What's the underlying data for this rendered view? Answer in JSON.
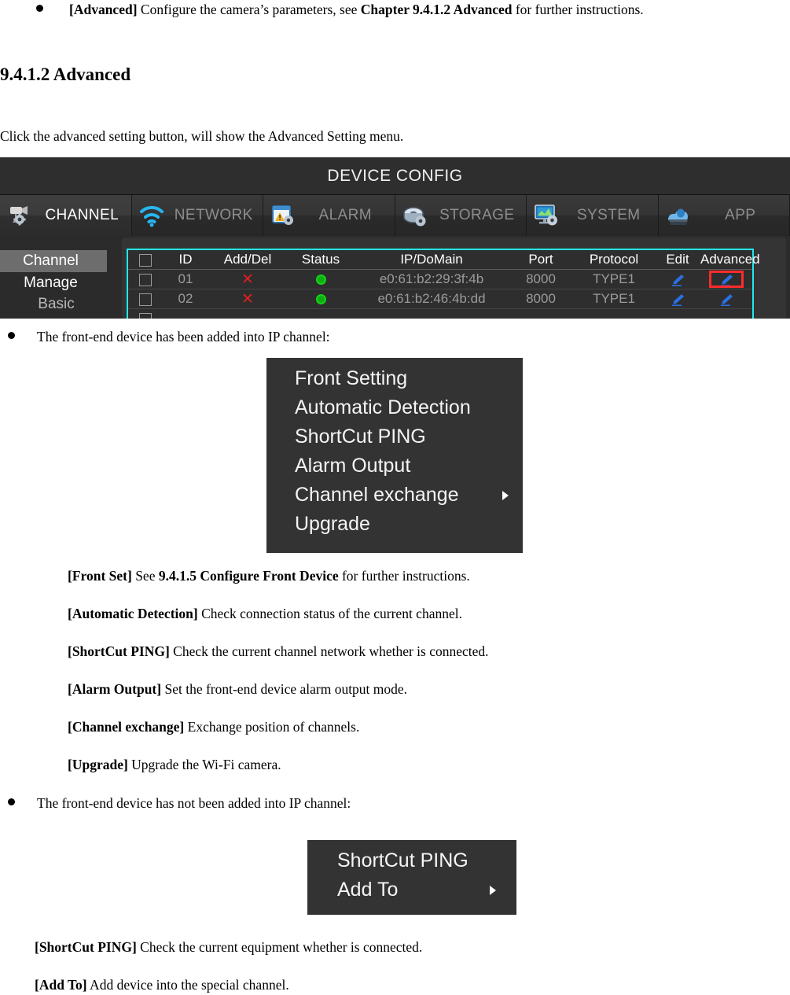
{
  "doc": {
    "bullet_advanced": {
      "label": "[Advanced]",
      "text_1": " Configure the camera’s parameters, see ",
      "ref": "Chapter 9.4.1.2 Advanced",
      "text_2": " for further instructions."
    },
    "heading": "9.4.1.2 Advanced",
    "intro": "Click the advanced setting button, will show the Advanced Setting menu.",
    "bullet_added": "The front-end device has been added into IP channel:",
    "bullet_not_added": "The front-end device has not been added into IP channel:",
    "definitions_added": [
      {
        "term": "[Front Set]",
        "body_1": " See ",
        "ref": "9.4.1.5 Configure Front Device",
        "body_2": " for further instructions."
      },
      {
        "term": "[Automatic Detection]",
        "body_1": " Check connection status of the current channel.",
        "ref": "",
        "body_2": ""
      },
      {
        "term": "[ShortCut PING]",
        "body_1": " Check the current channel network whether is connected.",
        "ref": "",
        "body_2": ""
      },
      {
        "term": "[Alarm Output]",
        "body_1": " Set the front-end device alarm output mode.",
        "ref": "",
        "body_2": ""
      },
      {
        "term": "[Channel exchange]",
        "body_1": " Exchange position of channels.",
        "ref": "",
        "body_2": ""
      },
      {
        "term": "[Upgrade]",
        "body_1": " Upgrade the Wi-Fi camera.",
        "ref": "",
        "body_2": ""
      }
    ],
    "definitions_not_added": [
      {
        "term": "[ShortCut PING]",
        "body_1": " Check the current equipment whether is connected.",
        "ref": "",
        "body_2": ""
      },
      {
        "term": "[Add To]",
        "body_1": " Add device into the special channel.",
        "ref": "",
        "body_2": ""
      }
    ]
  },
  "device_config": {
    "title": "DEVICE CONFIG",
    "tabs": [
      {
        "label": "CHANNEL",
        "icon": "camera-gear-icon",
        "active": true
      },
      {
        "label": "NETWORK",
        "icon": "wifi-icon",
        "active": false
      },
      {
        "label": "ALARM",
        "icon": "alarm-gear-icon",
        "active": false
      },
      {
        "label": "STORAGE",
        "icon": "disk-gear-icon",
        "active": false
      },
      {
        "label": "SYSTEM",
        "icon": "monitor-gear-icon",
        "active": false
      },
      {
        "label": "APP",
        "icon": "app-cloud-icon",
        "active": false
      }
    ],
    "sidebar": [
      {
        "label": "Channel Manage",
        "selected": true
      },
      {
        "label": "Basic",
        "selected": false
      }
    ],
    "table": {
      "columns": [
        "",
        "ID",
        "Add/Del",
        "Status",
        "IP/DoMain",
        "Port",
        "Protocol",
        "Edit",
        "Advanced"
      ],
      "rows": [
        {
          "checked": false,
          "id": "01",
          "add_del": "✕",
          "status": "online",
          "ip_domain": "e0:61:b2:29:3f:4b",
          "port": "8000",
          "protocol": "TYPE1",
          "edit": "edit-pencil-icon",
          "advanced": "advanced-pencil-icon",
          "advanced_highlighted": true
        },
        {
          "checked": false,
          "id": "02",
          "add_del": "✕",
          "status": "online",
          "ip_domain": "e0:61:b2:46:4b:dd",
          "port": "8000",
          "protocol": "TYPE1",
          "edit": "edit-pencil-icon",
          "advanced": "advanced-pencil-icon",
          "advanced_highlighted": false
        }
      ]
    },
    "colors": {
      "panel_bg": "#2b2b2b",
      "table_border": "#22e8ea",
      "highlight_box": "#ff2b2b",
      "status_online": "#0fae12",
      "delete_x": "#e01f1f",
      "pencil_blue": "#2a6fe0",
      "selected_item": "#6d6d6d"
    }
  },
  "menu_advanced": {
    "items": [
      {
        "label": "Front Setting",
        "submenu": false
      },
      {
        "label": "Automatic Detection",
        "submenu": false
      },
      {
        "label": "ShortCut PING",
        "submenu": false
      },
      {
        "label": "Alarm Output",
        "submenu": false
      },
      {
        "label": "Channel exchange",
        "submenu": true
      },
      {
        "label": "Upgrade",
        "submenu": false
      }
    ]
  },
  "menu_not_added": {
    "items": [
      {
        "label": "ShortCut PING",
        "submenu": false
      },
      {
        "label": "Add To",
        "submenu": true
      }
    ]
  }
}
